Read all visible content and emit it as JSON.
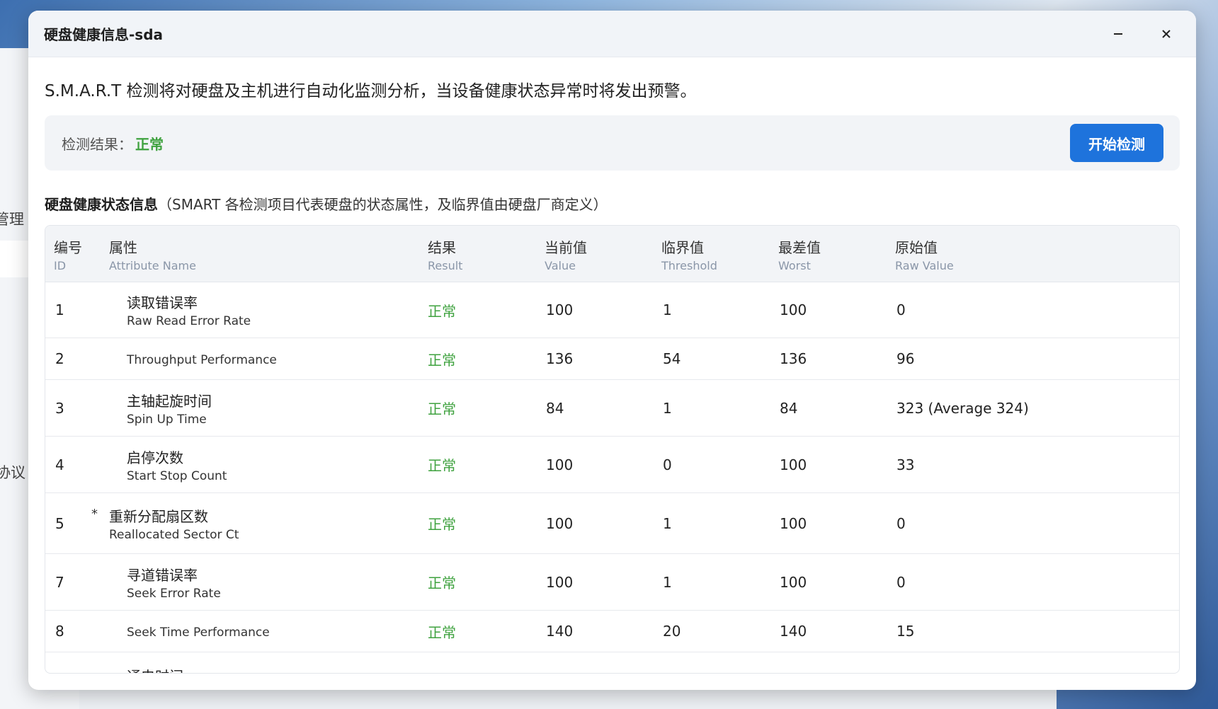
{
  "background": {
    "partial_label_1": "管理",
    "partial_label_2": "协议"
  },
  "modal": {
    "title": "硬盘健康信息-sda",
    "minimize_icon": "minus-icon",
    "close_icon": "close-icon"
  },
  "intro": "S.M.A.R.T 检测将对硬盘及主机进行自动化监测分析，当设备健康状态异常时将发出预警。",
  "result": {
    "label": "检测结果：",
    "value": "正常",
    "value_color": "#3fa23f",
    "start_button": "开始检测",
    "button_color": "#1e73dc"
  },
  "section": {
    "title": "硬盘健康状态信息",
    "note": "（SMART 各检测项目代表硬盘的状态属性，及临界值由硬盘厂商定义）"
  },
  "table": {
    "headers": [
      {
        "zh": "编号",
        "en": "ID"
      },
      {
        "zh": "属性",
        "en": "Attribute Name"
      },
      {
        "zh": "结果",
        "en": "Result"
      },
      {
        "zh": "当前值",
        "en": "Value"
      },
      {
        "zh": "临界值",
        "en": "Threshold"
      },
      {
        "zh": "最差值",
        "en": "Worst"
      },
      {
        "zh": "原始值",
        "en": "Raw Value"
      }
    ],
    "rows": [
      {
        "id": "1",
        "star": "",
        "name_zh": "读取错误率",
        "name_en": "Raw Read Error Rate",
        "result": "正常",
        "value": "100",
        "threshold": "1",
        "worst": "100",
        "raw": "0"
      },
      {
        "id": "2",
        "star": "",
        "name_zh": "",
        "name_en": "Throughput Performance",
        "result": "正常",
        "value": "136",
        "threshold": "54",
        "worst": "136",
        "raw": "96"
      },
      {
        "id": "3",
        "star": "",
        "name_zh": "主轴起旋时间",
        "name_en": "Spin Up Time",
        "result": "正常",
        "value": "84",
        "threshold": "1",
        "worst": "84",
        "raw": "323 (Average 324)"
      },
      {
        "id": "4",
        "star": "",
        "name_zh": "启停次数",
        "name_en": "Start Stop Count",
        "result": "正常",
        "value": "100",
        "threshold": "0",
        "worst": "100",
        "raw": "33"
      },
      {
        "id": "5",
        "star": "*",
        "name_zh": "重新分配扇区数",
        "name_en": "Reallocated Sector Ct",
        "result": "正常",
        "value": "100",
        "threshold": "1",
        "worst": "100",
        "raw": "0"
      },
      {
        "id": "7",
        "star": "",
        "name_zh": "寻道错误率",
        "name_en": "Seek Error Rate",
        "result": "正常",
        "value": "100",
        "threshold": "1",
        "worst": "100",
        "raw": "0"
      },
      {
        "id": "8",
        "star": "",
        "name_zh": "",
        "name_en": "Seek Time Performance",
        "result": "正常",
        "value": "140",
        "threshold": "20",
        "worst": "140",
        "raw": "15"
      },
      {
        "id": "",
        "star": "",
        "name_zh": "通电时间",
        "name_en": "",
        "result": "",
        "value": "",
        "threshold": "",
        "worst": "",
        "raw": ""
      }
    ]
  }
}
